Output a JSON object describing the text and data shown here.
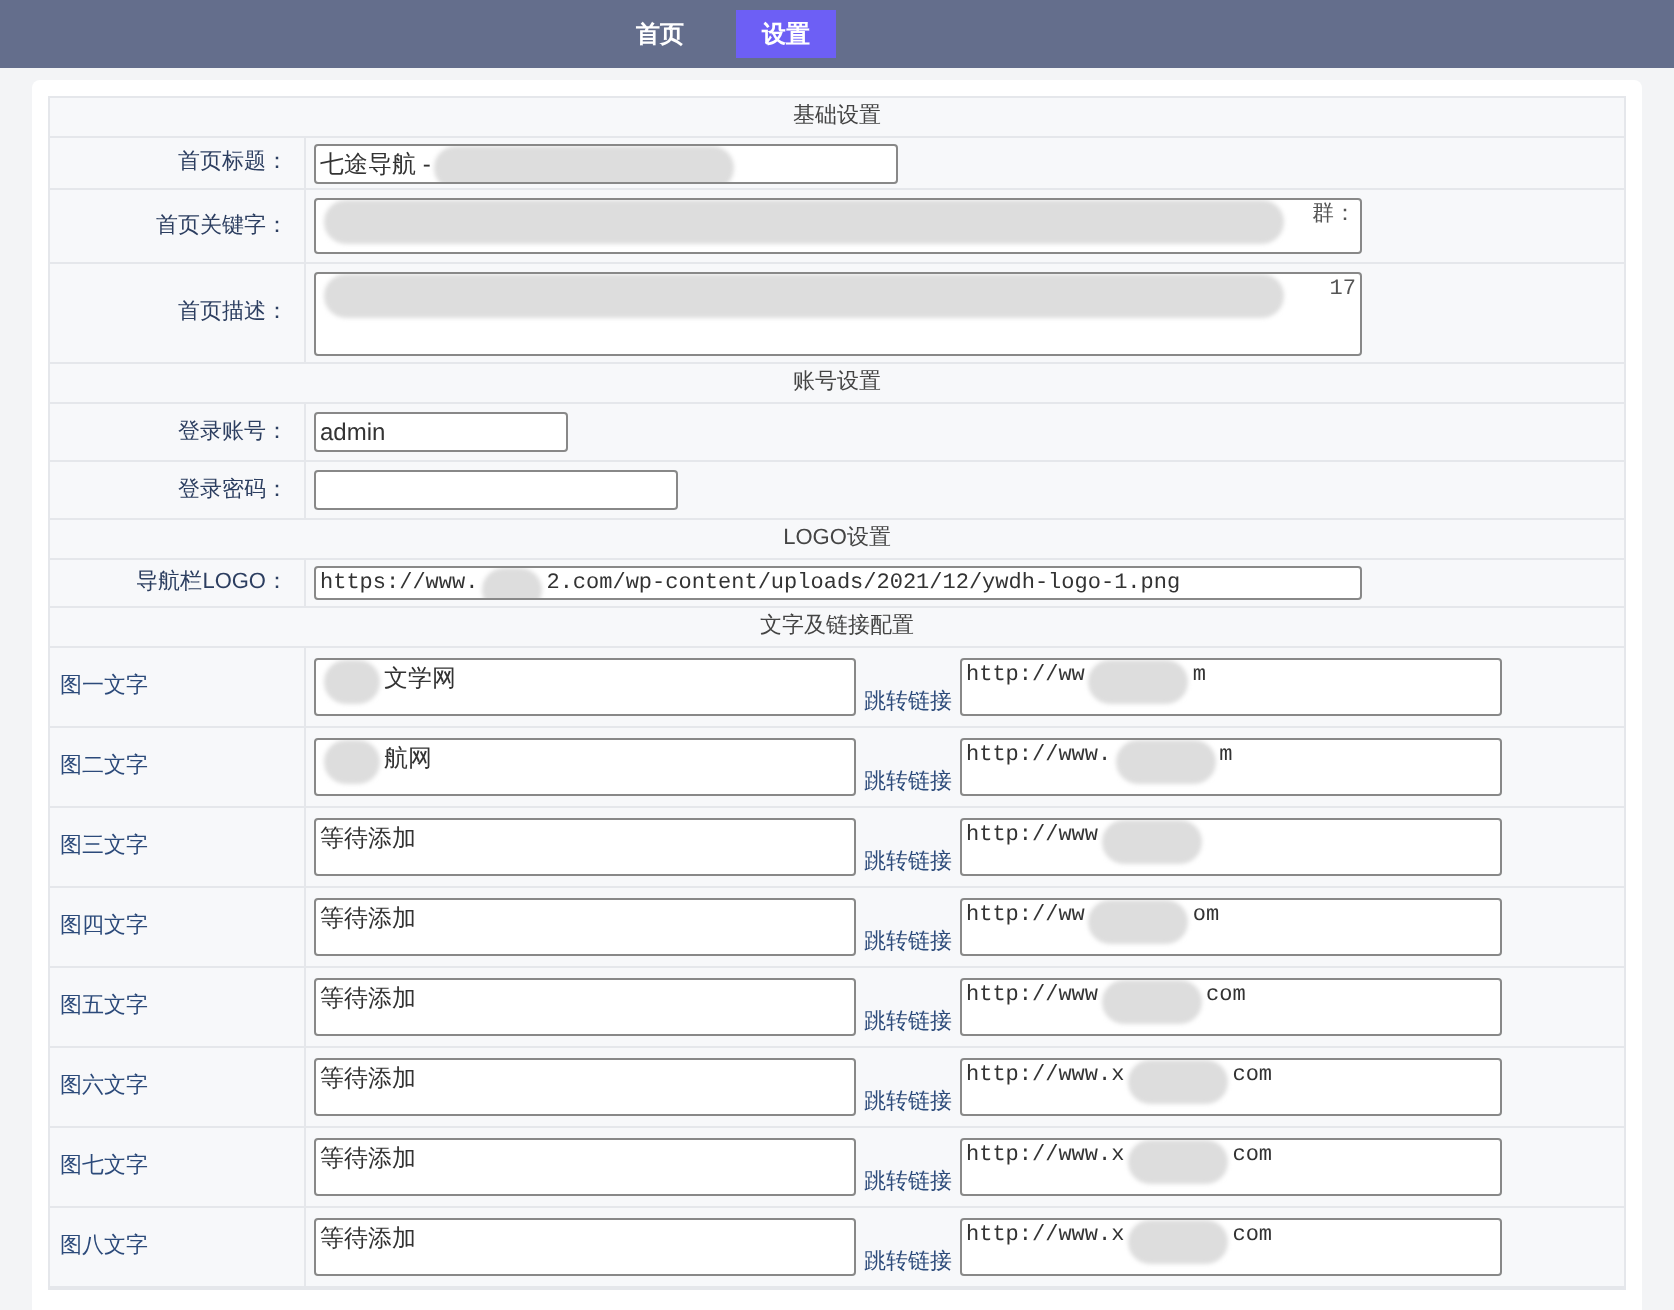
{
  "nav": [
    {
      "label": "首页",
      "selected": false
    },
    {
      "label": "设置",
      "selected": true
    }
  ],
  "basic": {
    "heading": "基础设置",
    "fields": [
      {
        "kind": "input",
        "label": "首页标题：",
        "value": "七途导航 -",
        "redacted": true
      },
      {
        "kind": "textarea",
        "label": "首页关键字：",
        "value_end": "群：",
        "redacted": true
      },
      {
        "kind": "textarea_tall",
        "label": "首页描述：",
        "value_end": "17",
        "redacted": true
      }
    ]
  },
  "account": {
    "heading": "账号设置",
    "fields": [
      {
        "kind": "short",
        "label": "登录账号：",
        "value": "admin"
      },
      {
        "kind": "password",
        "label": "登录密码："
      }
    ]
  },
  "logo": {
    "heading": "LOGO设置",
    "label": "导航栏LOGO：",
    "value_start": "https://www.",
    "value_end": "2.com/wp-content/uploads/2021/12/ywdh-logo-1.png"
  },
  "links": {
    "heading": "文字及链接配置",
    "rows": [
      {
        "label": "图一文字",
        "text": "文学网",
        "text_redacted": true,
        "link_label": "跳转链接",
        "url_start": "http://ww",
        "url_end": "m"
      },
      {
        "label": "图二文字",
        "text": "航网",
        "text_redacted": true,
        "link_label": "跳转链接",
        "url_start": "http://www.",
        "url_end": "m"
      },
      {
        "label": "图三文字",
        "text": "等待添加",
        "link_label": "跳转链接",
        "url_start": "http://www"
      },
      {
        "label": "图四文字",
        "text": "等待添加",
        "link_label": "跳转链接",
        "url_start": "http://ww",
        "url_end": "om"
      },
      {
        "label": "图五文字",
        "text": "等待添加",
        "link_label": "跳转链接",
        "url_start": "http://www",
        "url_end": "com"
      },
      {
        "label": "图六文字",
        "text": "等待添加",
        "link_label": "跳转链接",
        "url_start": "http://www.x",
        "url_end": "com"
      },
      {
        "label": "图七文字",
        "text": "等待添加",
        "link_label": "跳转链接",
        "url_start": "http://www.x",
        "url_end": "com"
      },
      {
        "label": "图八文字",
        "text": "等待添加",
        "link_label": "跳转链接",
        "url_start": "http://www.x",
        "url_end": "com"
      }
    ]
  }
}
